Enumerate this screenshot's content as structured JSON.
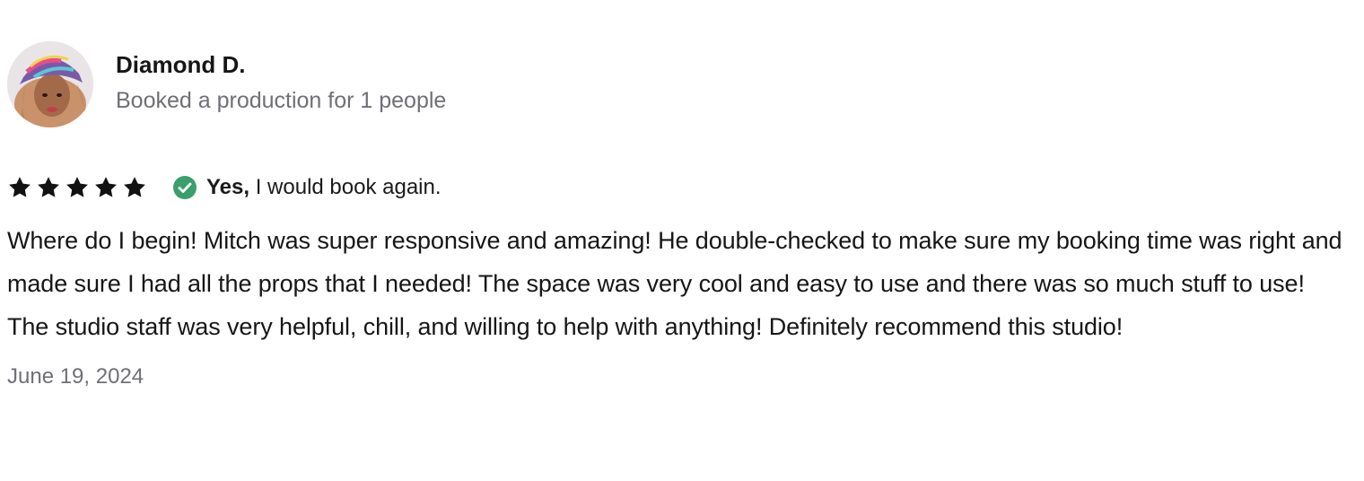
{
  "review": {
    "reviewer_name": "Diamond D.",
    "booking_info": "Booked a production for 1 people",
    "rating": 5,
    "max_rating": 5,
    "recommend_yes": "Yes,",
    "recommend_text": " I would book again.",
    "text": "Where do I begin! Mitch was super responsive and amazing! He double-checked to make sure my booking time was right and made sure I had all the props that I needed! The space was very cool and easy to use and there was so much stuff to use! The studio staff was very helpful, chill, and willing to help with anything! Definitely recommend this studio!",
    "date": "June 19, 2024"
  },
  "icons": {
    "star": "star-icon",
    "check": "check-circle-icon"
  },
  "colors": {
    "star": "#111111",
    "check_green": "#3a9f6a",
    "muted_text": "#6f6f76"
  }
}
